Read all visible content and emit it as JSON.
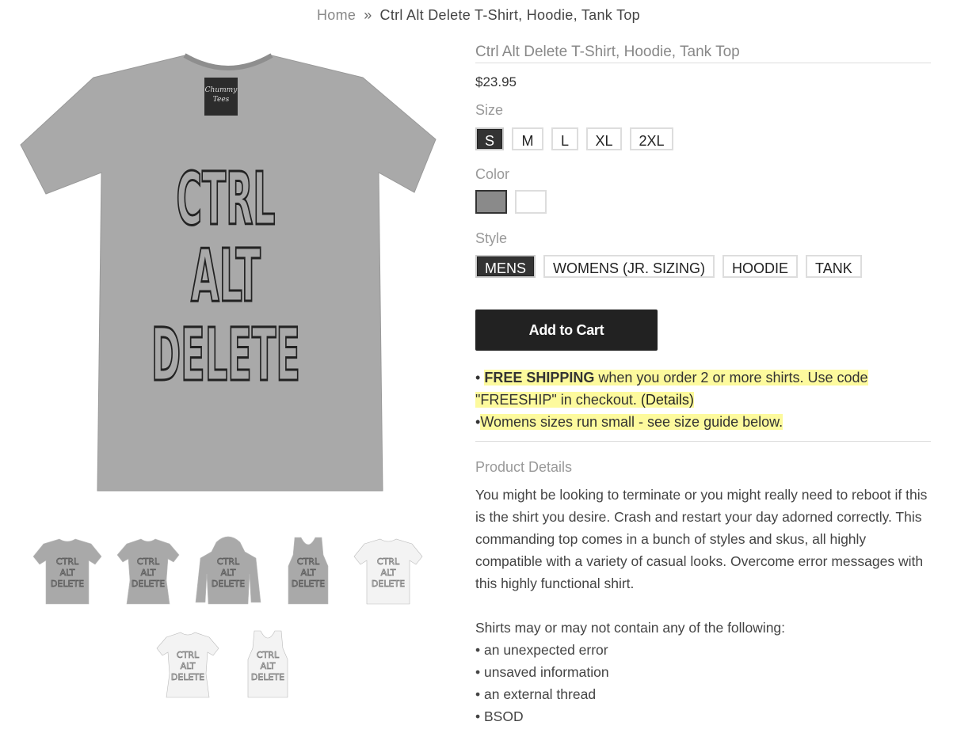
{
  "breadcrumb": {
    "home": "Home",
    "separator": "»",
    "current": "Ctrl Alt Delete T-Shirt, Hoodie, Tank Top"
  },
  "product": {
    "title": "Ctrl Alt Delete T-Shirt, Hoodie, Tank Top",
    "price": "$23.95",
    "shirt_text": [
      "CTRL",
      "ALT",
      "DELETE"
    ],
    "tag_text": [
      "Chummy",
      "Tees"
    ]
  },
  "size": {
    "label": "Size",
    "options": [
      "S",
      "M",
      "L",
      "XL",
      "2XL"
    ],
    "selected": "S"
  },
  "color": {
    "label": "Color",
    "options": [
      "#8a8a8a",
      "#ffffff"
    ],
    "selected": "#8a8a8a"
  },
  "style": {
    "label": "Style",
    "options": [
      "MENS",
      "WOMENS (JR. SIZING)",
      "HOODIE",
      "TANK"
    ],
    "selected": "MENS"
  },
  "cart": {
    "label": "Add to Cart"
  },
  "notes": {
    "bullet": "•",
    "free_shipping": "FREE SHIPPING",
    "shipping_rest_1": " when you order 2 or more shirts. Use code",
    "shipping_rest_2": "\"FREESHIP\" in checkout.",
    "details_link": "(Details)",
    "womens": "Womens sizes run small - see size guide below."
  },
  "details": {
    "title": "Product Details",
    "description": [
      "You might be looking to terminate or you might really need to reboot if this",
      "is the shirt you desire. Crash and restart your day adorned correctly. This",
      "commanding top comes in a bunch of styles and skus, all highly",
      "compatible with a variety of casual looks. Overcome error messages with",
      "this highly functional shirt."
    ],
    "list_intro": "Shirts may or may not contain any of the following:",
    "list": [
      "• an unexpected error",
      "• unsaved information",
      "• an external thread",
      "• BSOD"
    ]
  },
  "colors": {
    "highlight": "#fdfa9d",
    "button": "#222222",
    "heather_grey": "#a9a9a9",
    "white_shirt": "#f3f3f3"
  },
  "thumbnails": [
    {
      "name": "thumb-mens-grey",
      "kind": "tee",
      "color": "grey"
    },
    {
      "name": "thumb-womens-grey",
      "kind": "tee-fitted",
      "color": "grey"
    },
    {
      "name": "thumb-hoodie-grey",
      "kind": "hoodie",
      "color": "grey"
    },
    {
      "name": "thumb-tank-grey",
      "kind": "tank",
      "color": "grey"
    },
    {
      "name": "thumb-mens-white",
      "kind": "tee",
      "color": "white"
    },
    {
      "name": "thumb-womens-white",
      "kind": "tee-fitted",
      "color": "white"
    },
    {
      "name": "thumb-tank-white",
      "kind": "tank",
      "color": "white"
    }
  ]
}
